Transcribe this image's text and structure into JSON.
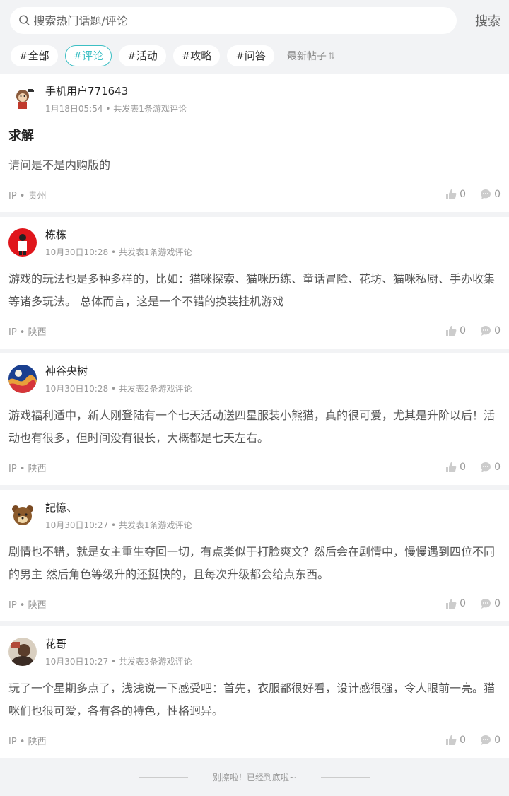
{
  "search": {
    "placeholder": "搜索热门话题/评论",
    "button": "搜索"
  },
  "tags": [
    {
      "label": "#全部",
      "active": false
    },
    {
      "label": "#评论",
      "active": true
    },
    {
      "label": "#活动",
      "active": false
    },
    {
      "label": "#攻略",
      "active": false
    },
    {
      "label": "#问答",
      "active": false
    }
  ],
  "sort": {
    "label": "最新帖子",
    "icon": "sort-arrows-icon"
  },
  "accent_color": "#3cbfc4",
  "posts": [
    {
      "user": "手机用户771643",
      "date": "1月18日05:54",
      "summary": "共发表1条游戏评论",
      "title": "求解",
      "content": "请问是不是内购版的",
      "ip": "IP • 贵州",
      "likes": "0",
      "comments": "0"
    },
    {
      "user": "栋栋",
      "date": "10月30日10:28",
      "summary": "共发表1条游戏评论",
      "title": "",
      "content": "游戏的玩法也是多种多样的，比如：猫咪探索、猫咪历练、童话冒险、花坊、猫咪私厨、手办收集等诸多玩法。 总体而言，这是一个不错的换装挂机游戏",
      "ip": "IP • 陕西",
      "likes": "0",
      "comments": "0"
    },
    {
      "user": "神谷央树",
      "date": "10月30日10:28",
      "summary": "共发表2条游戏评论",
      "title": "",
      "content": "游戏福利适中，新人刚登陆有一个七天活动送四星服装小熊猫，真的很可爱，尤其是升阶以后！活动也有很多，但时间没有很长，大概都是七天左右。",
      "ip": "IP • 陕西",
      "likes": "0",
      "comments": "0"
    },
    {
      "user": "記憶、",
      "date": "10月30日10:27",
      "summary": "共发表1条游戏评论",
      "title": "",
      "content": "剧情也不错，就是女主重生夺回一切，有点类似于打脸爽文？然后会在剧情中，慢慢遇到四位不同的男主 然后角色等级升的还挺快的，且每次升级都会给点东西。",
      "ip": "IP • 陕西",
      "likes": "0",
      "comments": "0"
    },
    {
      "user": "花哥",
      "date": "10月30日10:27",
      "summary": "共发表3条游戏评论",
      "title": "",
      "content": "玩了一个星期多点了，浅浅说一下感受吧：首先，衣服都很好看，设计感很强，令人眼前一亮。猫咪们也很可爱，各有各的特色，性格迥异。",
      "ip": "IP • 陕西",
      "likes": "0",
      "comments": "0"
    }
  ],
  "end_text": "别擦啦！已经到底啦~"
}
